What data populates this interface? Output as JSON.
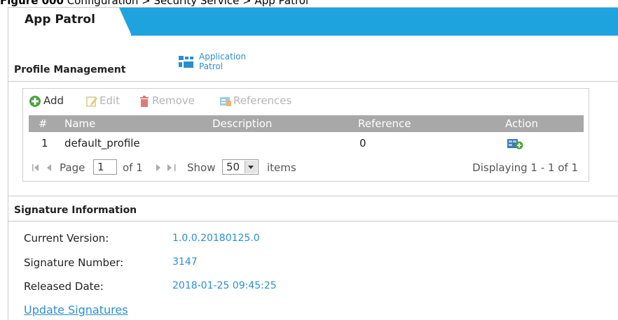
{
  "caption": {
    "figure": "Figure 000",
    "rest": " Configuration > Security Service > App Patrol"
  },
  "tab": {
    "label": "App Patrol"
  },
  "app_link": {
    "line1": "Application",
    "line2": "Patrol"
  },
  "profile_management": {
    "title": "Profile Management",
    "toolbar": {
      "add": "Add",
      "edit": "Edit",
      "remove": "Remove",
      "references": "References"
    },
    "columns": {
      "index": "#",
      "name": "Name",
      "description": "Description",
      "reference": "Reference",
      "action": "Action"
    },
    "rows": [
      {
        "index": "1",
        "name": "default_profile",
        "description": "",
        "reference": "0"
      }
    ],
    "pager": {
      "page_label": "Page",
      "page_value": "1",
      "of_label": "of 1",
      "show_label": "Show",
      "show_value": "50",
      "items_label": "items",
      "displaying": "Displaying 1 - 1 of 1"
    }
  },
  "signature_information": {
    "title": "Signature Information",
    "current_version_label": "Current Version:",
    "current_version": "1.0.0.20180125.0",
    "signature_number_label": "Signature Number:",
    "signature_number": "3147",
    "released_date_label": "Released Date:",
    "released_date": "2018-01-25 09:45:25",
    "update_link": "Update Signatures"
  },
  "colors": {
    "tab_bar": "#1ea3df",
    "link": "#2a8fd0",
    "table_header": "#a8a8a8"
  }
}
